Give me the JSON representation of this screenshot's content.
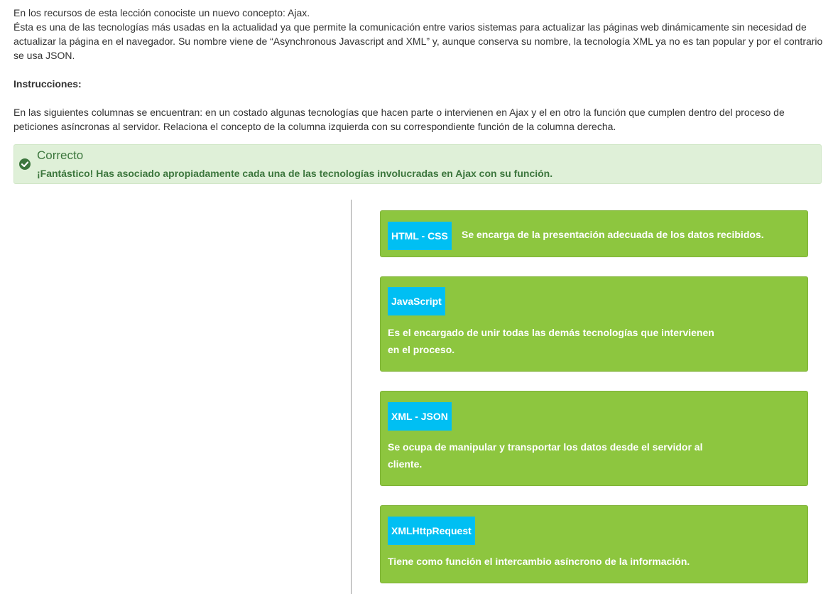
{
  "intro": {
    "line1": "En los recursos de esta lección conociste un nuevo concepto: Ajax.",
    "line2": "Ésta es una de las tecnologías más usadas en la actualidad ya que permite la comunicación entre varios sistemas para actualizar las páginas web dinámicamente sin necesidad de actualizar la página en el navegador. Su nombre viene de “Asynchronous Javascript and XML” y, aunque conserva su nombre, la tecnología XML ya no es tan popular y por el contrario se usa JSON."
  },
  "instructions": {
    "heading": "Instrucciones:",
    "text": "En las siguientes columnas se encuentran: en un costado algunas tecnologías que hacen parte o intervienen en Ajax y el en otro la función que cumplen dentro del proceso de peticiones asíncronas al servidor. Relaciona el concepto de la columna izquierda con su correspondiente función de la columna derecha."
  },
  "feedback": {
    "icon": "check-circle-icon",
    "title": "Correcto",
    "message": "¡Fantástico! Has asociado apropiadamente cada una de las tecnologías involucradas en Ajax con su función."
  },
  "matches": [
    {
      "tag": "HTML - CSS",
      "description": "Se encarga de la presentación adecuada de los datos recibidos."
    },
    {
      "tag": "JavaScript",
      "description": "Es el encargado de unir todas las demás tecnologías que intervienen en el proceso."
    },
    {
      "tag": "XML - JSON",
      "description": "Se ocupa de manipular y transportar los datos desde el servidor al cliente."
    },
    {
      "tag": "XMLHttpRequest",
      "description": "Tiene como función el intercambio asíncrono de la información."
    }
  ],
  "colors": {
    "success_bg": "#dff0d8",
    "success_text": "#3c763d",
    "card_green": "#8dc63f",
    "tag_blue": "#00bff3"
  }
}
